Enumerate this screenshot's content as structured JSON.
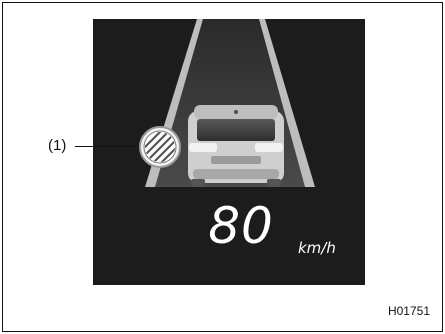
{
  "callout": {
    "label": "(1)",
    "target": "no-passing-sign-icon"
  },
  "speed": {
    "value": "80",
    "unit": "km/h"
  },
  "figure_code": "H01751",
  "colors": {
    "display_bg": "#1c1c1c",
    "road": "#3d3d3d",
    "lane_line": "#bdbdbd",
    "vehicle": "#cfcfcf",
    "text": "#ffffff"
  }
}
